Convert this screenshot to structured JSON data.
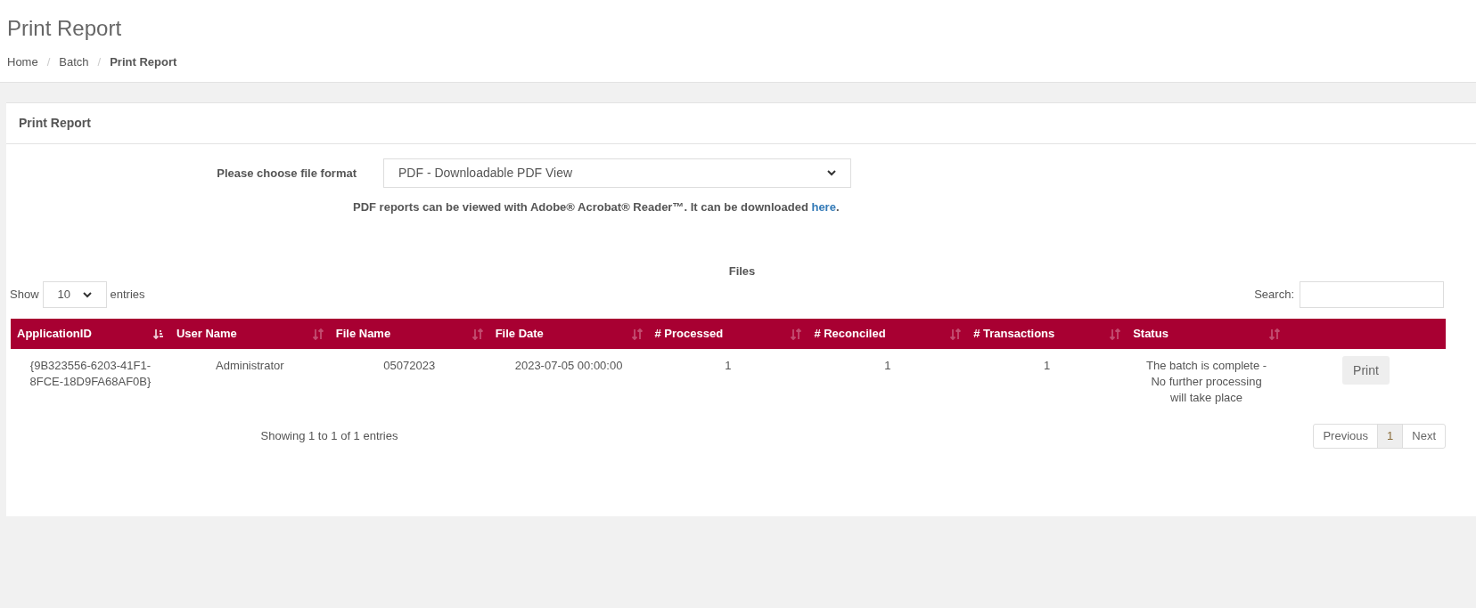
{
  "page_title": "Print Report",
  "breadcrumb_separator": "/",
  "breadcrumb": [
    {
      "label": "Home",
      "current": false
    },
    {
      "label": "Batch",
      "current": false
    },
    {
      "label": "Print Report",
      "current": true
    }
  ],
  "card": {
    "title": "Print Report",
    "format_label": "Please choose file format",
    "format_value": "PDF - Downloadable PDF View",
    "note": "PDF reports can be viewed with Adobe® Acrobat® Reader™. It can be downloaded ",
    "note_link": "here",
    "note_end": ".",
    "table_title": "Files",
    "length": {
      "before": "Show",
      "value": "10",
      "after": "entries"
    },
    "search_label": "Search:",
    "columns": [
      {
        "label": "ApplicationID",
        "sorted": true
      },
      {
        "label": "User Name",
        "sorted": false
      },
      {
        "label": "File Name",
        "sorted": false
      },
      {
        "label": "File Date",
        "sorted": false
      },
      {
        "label": "# Processed",
        "sorted": false
      },
      {
        "label": "# Reconciled",
        "sorted": false
      },
      {
        "label": "# Transactions",
        "sorted": false
      },
      {
        "label": "Status",
        "sorted": false
      }
    ],
    "rows": [
      {
        "cells": [
          "{9B323556-6203-41F1-8FCE-18D9FA68AF0B}",
          "Administrator",
          "05072023",
          "2023-07-05 00:00:00",
          "1",
          "1",
          "1",
          "The batch is complete - No further processing will take place"
        ],
        "action": "Print"
      }
    ],
    "info": "Showing 1 to 1 of 1 entries",
    "pagination": [
      {
        "label": "Previous",
        "selected": false
      },
      {
        "label": "1",
        "selected": true
      },
      {
        "label": "Next",
        "selected": false
      }
    ]
  }
}
